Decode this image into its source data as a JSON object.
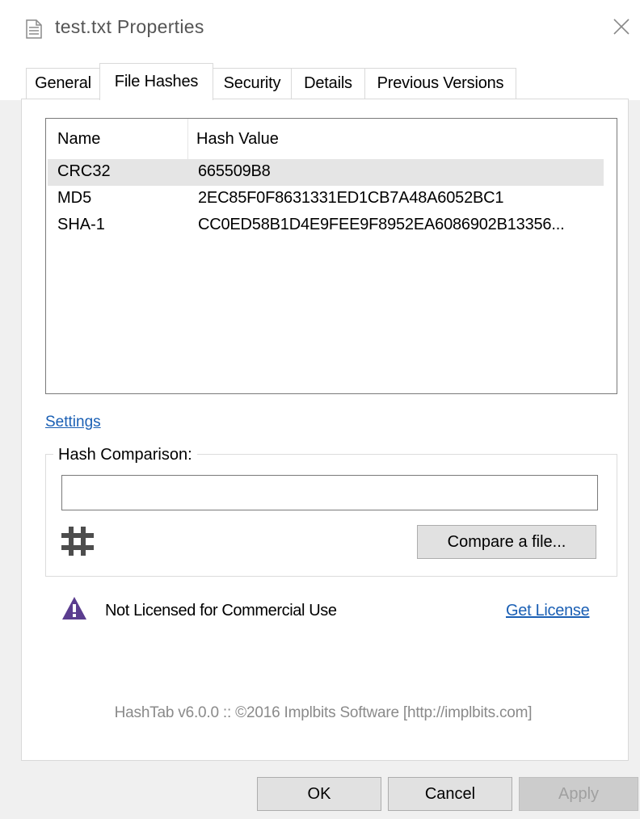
{
  "window": {
    "title": "test.txt Properties",
    "title_icon": "text-file-icon",
    "close_icon": "close-icon"
  },
  "tabs": [
    {
      "label": "General",
      "active": false
    },
    {
      "label": "File Hashes",
      "active": true
    },
    {
      "label": "Security",
      "active": false
    },
    {
      "label": "Details",
      "active": false
    },
    {
      "label": "Previous Versions",
      "active": false
    }
  ],
  "hash_list": {
    "columns": [
      "Name",
      "Hash Value"
    ],
    "rows": [
      {
        "name": "CRC32",
        "hash": "665509B8",
        "selected": true
      },
      {
        "name": "MD5",
        "hash": "2EC85F0F8631331ED1CB7A48A6052BC1",
        "selected": false
      },
      {
        "name": "SHA-1",
        "hash": "CC0ED58B1D4E9FEE9F8952EA6086902B13356...",
        "selected": false
      }
    ]
  },
  "settings_link": "Settings",
  "hash_comparison": {
    "label": "Hash Comparison:",
    "value": "",
    "icon": "hash-icon",
    "compare_button": "Compare a file..."
  },
  "license": {
    "icon": "warning-icon",
    "text": "Not Licensed for Commercial Use",
    "link": "Get License"
  },
  "footer": "HashTab v6.0.0 :: ©2016 Implbits Software [http://implbits.com]",
  "buttons": {
    "ok": "OK",
    "cancel": "Cancel",
    "apply": "Apply"
  },
  "colors": {
    "link": "#1a5fb4",
    "warning": "#5b3d8f",
    "selection": "#e5e5e5"
  }
}
